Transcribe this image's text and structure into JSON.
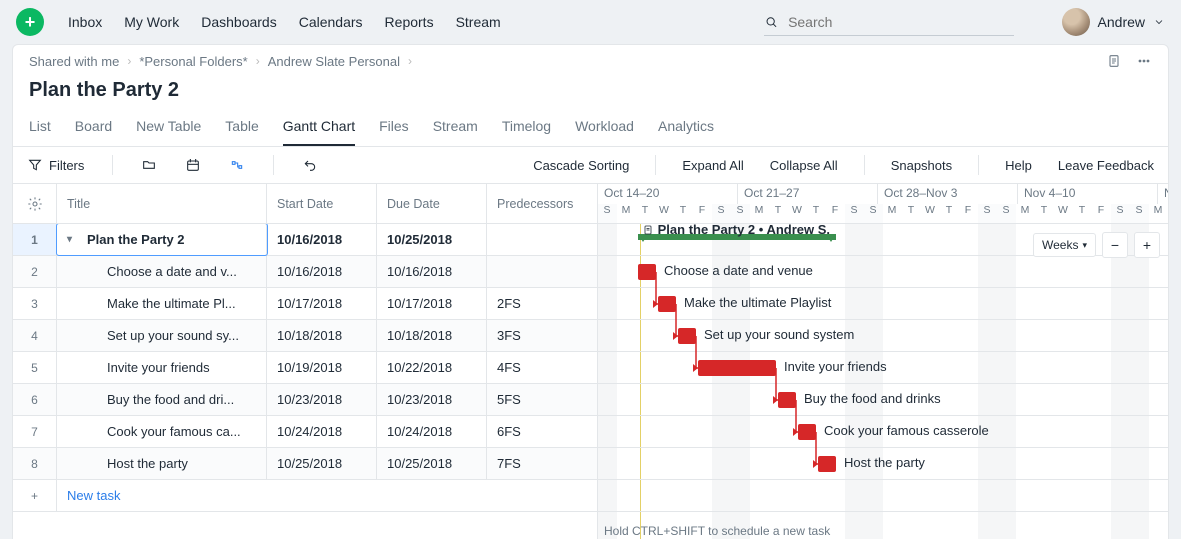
{
  "nav": {
    "items": [
      "Inbox",
      "My Work",
      "Dashboards",
      "Calendars",
      "Reports",
      "Stream"
    ]
  },
  "search": {
    "placeholder": "Search"
  },
  "user": {
    "name": "Andrew"
  },
  "breadcrumbs": [
    "Shared with me",
    "*Personal Folders*",
    "Andrew Slate Personal"
  ],
  "page_title": "Plan the Party 2",
  "tabs": [
    "List",
    "Board",
    "New Table",
    "Table",
    "Gantt Chart",
    "Files",
    "Stream",
    "Timelog",
    "Workload",
    "Analytics"
  ],
  "active_tab": "Gantt Chart",
  "toolbar": {
    "filters": "Filters",
    "right": [
      "Cascade Sorting",
      "Expand All",
      "Collapse All",
      "Snapshots",
      "Help",
      "Leave Feedback"
    ]
  },
  "grid": {
    "gear_tip": "Settings",
    "columns": [
      "Title",
      "Start Date",
      "Due Date",
      "Predecessors"
    ],
    "rows": [
      {
        "num": 1,
        "title": "Plan the Party 2",
        "start": "10/16/2018",
        "due": "10/25/2018",
        "pred": "",
        "level": 0,
        "isParent": true,
        "selected": true,
        "full": "Plan the Party 2"
      },
      {
        "num": 2,
        "title": "Choose a date and v...",
        "start": "10/16/2018",
        "due": "10/16/2018",
        "pred": "",
        "level": 1,
        "full": "Choose a date and venue"
      },
      {
        "num": 3,
        "title": "Make the ultimate Pl...",
        "start": "10/17/2018",
        "due": "10/17/2018",
        "pred": "2FS",
        "level": 1,
        "full": "Make the ultimate Playlist"
      },
      {
        "num": 4,
        "title": "Set up your sound sy...",
        "start": "10/18/2018",
        "due": "10/18/2018",
        "pred": "3FS",
        "level": 1,
        "full": "Set up your sound system"
      },
      {
        "num": 5,
        "title": "Invite your friends",
        "start": "10/19/2018",
        "due": "10/22/2018",
        "pred": "4FS",
        "level": 1,
        "full": "Invite your friends"
      },
      {
        "num": 6,
        "title": "Buy the food and dri...",
        "start": "10/23/2018",
        "due": "10/23/2018",
        "pred": "5FS",
        "level": 1,
        "full": "Buy the food and drinks"
      },
      {
        "num": 7,
        "title": "Cook your famous ca...",
        "start": "10/24/2018",
        "due": "10/24/2018",
        "pred": "6FS",
        "level": 1,
        "full": "Cook your famous casserole"
      },
      {
        "num": 8,
        "title": "Host the party",
        "start": "10/25/2018",
        "due": "10/25/2018",
        "pred": "7FS",
        "level": 1,
        "full": "Host the party"
      }
    ],
    "new_task": "New task"
  },
  "timeline": {
    "day_width": 20,
    "start_day_index": 0,
    "weeks": [
      "Oct 14–20",
      "Oct 21–27",
      "Oct 28–Nov 3",
      "Nov 4–10",
      "N"
    ],
    "day_letters": [
      "S",
      "M",
      "T",
      "W",
      "T",
      "F",
      "S"
    ],
    "num_days": 30,
    "summary_label": "Plan the Party 2 • Andrew S.",
    "zoom_label": "Weeks",
    "hint": "Hold CTRL+SHIFT to schedule a new task"
  },
  "chart_data": {
    "type": "gantt",
    "timeline_origin": "2018-10-14",
    "tasks": [
      {
        "id": 1,
        "name": "Plan the Party 2",
        "start": "2018-10-16",
        "end": "2018-10-25",
        "summary": true,
        "owner": "Andrew S."
      },
      {
        "id": 2,
        "name": "Choose a date and venue",
        "start": "2018-10-16",
        "end": "2018-10-16",
        "pred": null
      },
      {
        "id": 3,
        "name": "Make the ultimate Playlist",
        "start": "2018-10-17",
        "end": "2018-10-17",
        "pred": "2FS"
      },
      {
        "id": 4,
        "name": "Set up your sound system",
        "start": "2018-10-18",
        "end": "2018-10-18",
        "pred": "3FS"
      },
      {
        "id": 5,
        "name": "Invite your friends",
        "start": "2018-10-19",
        "end": "2018-10-22",
        "pred": "4FS"
      },
      {
        "id": 6,
        "name": "Buy the food and drinks",
        "start": "2018-10-23",
        "end": "2018-10-23",
        "pred": "5FS"
      },
      {
        "id": 7,
        "name": "Cook your famous casserole",
        "start": "2018-10-24",
        "end": "2018-10-24",
        "pred": "6FS"
      },
      {
        "id": 8,
        "name": "Host the party",
        "start": "2018-10-25",
        "end": "2018-10-25",
        "pred": "7FS"
      }
    ]
  }
}
